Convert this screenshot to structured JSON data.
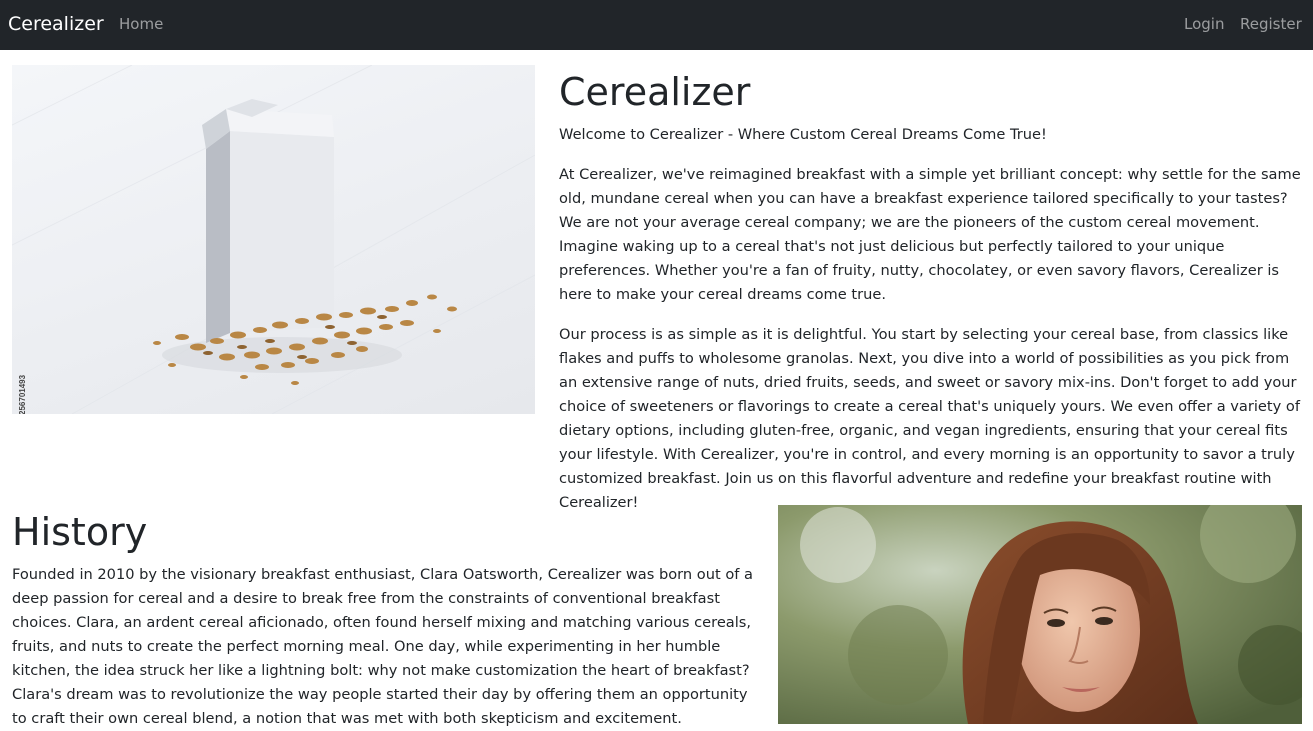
{
  "navbar": {
    "brand": "Cerealizer",
    "home_label": "Home",
    "login_label": "Login",
    "register_label": "Register",
    "background": "#212529"
  },
  "hero_image": {
    "watermark": "Adobe Stock | #256701493"
  },
  "intro_section": {
    "title": "Cerealizer",
    "welcome": "Welcome to Cerealizer - Where Custom Cereal Dreams Come True!",
    "paragraph1": "At Cerealizer, we've reimagined breakfast with a simple yet brilliant concept: why settle for the same old, mundane cereal when you can have a breakfast experience tailored specifically to your tastes? We are not your average cereal company; we are the pioneers of the custom cereal movement. Imagine waking up to a cereal that's not just delicious but perfectly tailored to your unique preferences. Whether you're a fan of fruity, nutty, chocolatey, or even savory flavors, Cerealizer is here to make your cereal dreams come true.",
    "paragraph2": "Our process is as simple as it is delightful. You start by selecting your cereal base, from classics like flakes and puffs to wholesome granolas. Next, you dive into a world of possibilities as you pick from an extensive range of nuts, dried fruits, seeds, and sweet or savory mix-ins. Don't forget to add your choice of sweeteners or flavorings to create a cereal that's uniquely yours. We even offer a variety of dietary options, including gluten-free, organic, and vegan ingredients, ensuring that your cereal fits your lifestyle. With Cerealizer, you're in control, and every morning is an opportunity to savor a truly customized breakfast. Join us on this flavorful adventure and redefine your breakfast routine with Cerealizer!"
  },
  "history_section": {
    "title": "History",
    "text": "Founded in 2010 by the visionary breakfast enthusiast, Clara Oatsworth, Cerealizer was born out of a deep passion for cereal and a desire to break free from the constraints of conventional breakfast choices. Clara, an ardent cereal aficionado, often found herself mixing and matching various cereals, fruits, and nuts to create the perfect morning meal. One day, while experimenting in her humble kitchen, the idea struck her like a lightning bolt: why not make customization the heart of breakfast? Clara's dream was to revolutionize the way people started their day by offering them an opportunity to craft their own cereal blend, a notion that was met with both skepticism and excitement."
  }
}
